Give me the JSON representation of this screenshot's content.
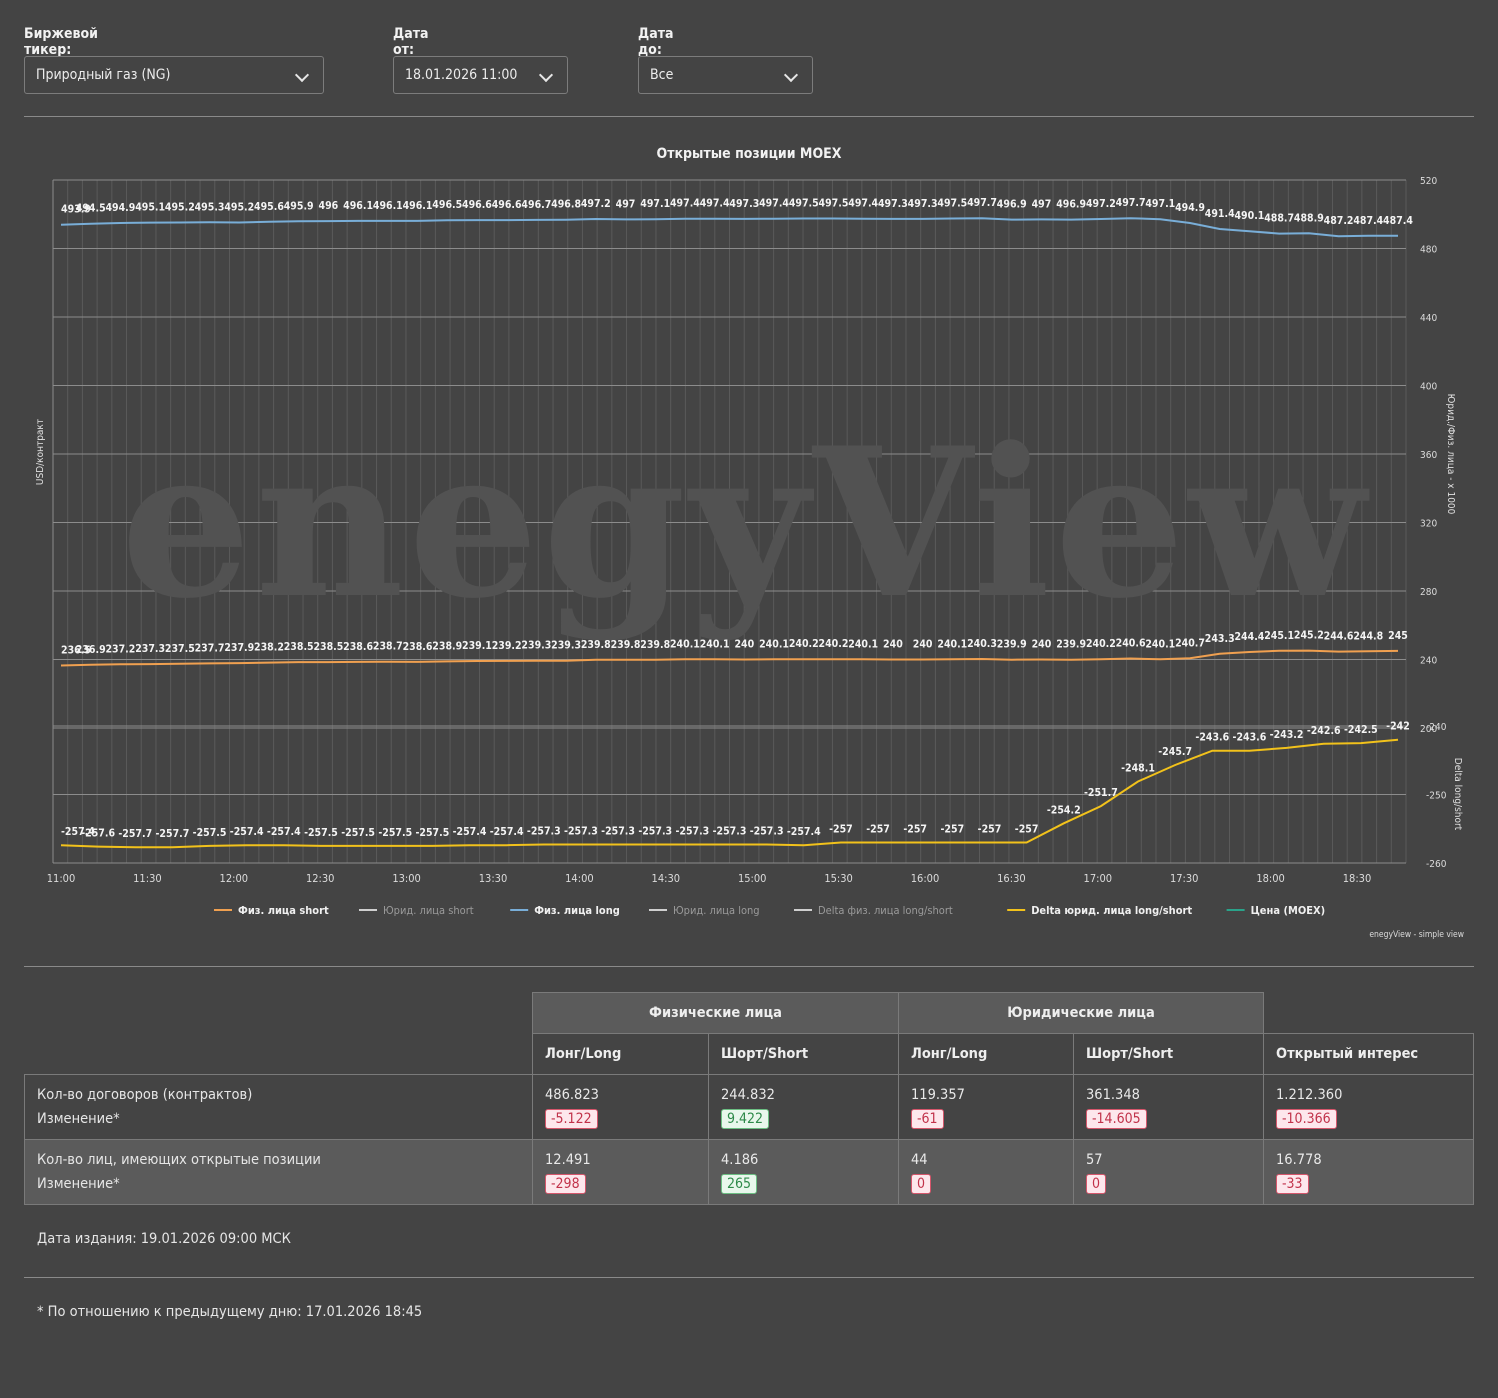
{
  "filters": {
    "ticker": {
      "label": "Биржевой тикер:",
      "value": "Природный газ (NG)"
    },
    "date_from": {
      "label": "Дата от:",
      "value": "18.01.2026 11:00"
    },
    "date_to": {
      "label": "Дата до:",
      "value": "Все"
    }
  },
  "chart_data": {
    "type": "line",
    "title": "Открытые позиции MOEX",
    "watermark": "enegyView",
    "credit": "enegyView - simple view",
    "ylabel_left": "USD/контракт",
    "ylabel_right_top": "Юрид./Физ. лица - x 1000",
    "ylabel_right_bottom": "Delta long/short",
    "top_axis": {
      "ticks": [
        "520",
        "480",
        "440",
        "400",
        "360",
        "320",
        "280",
        "240",
        "200"
      ],
      "ylim": [
        200,
        520
      ]
    },
    "bottom_axis": {
      "ticks": [
        "-240",
        "-250",
        "-260"
      ],
      "ylim": [
        -260,
        -240
      ]
    },
    "x_ticks": [
      "11:00",
      "11:30",
      "12:00",
      "12:30",
      "13:00",
      "13:30",
      "14:00",
      "14:30",
      "15:00",
      "15:30",
      "16:00",
      "16:30",
      "17:00",
      "17:30",
      "18:00",
      "18:30"
    ],
    "legend": [
      {
        "name": "Физ. лица short",
        "color": "#f0a050",
        "active": true
      },
      {
        "name": "Юрид. лица short",
        "color": "#d0d0d0",
        "active": false
      },
      {
        "name": "Физ. лица long",
        "color": "#79aed8",
        "active": true
      },
      {
        "name": "Юрид. лица long",
        "color": "#d0d0d0",
        "active": false
      },
      {
        "name": "Delta физ. лица long/short",
        "color": "#d0d0d0",
        "active": false
      },
      {
        "name": "Delta юрид. лица long/short",
        "color": "#f2c21b",
        "active": true
      },
      {
        "name": "Цена (MOEX)",
        "color": "#2aa38a",
        "active": true
      }
    ],
    "series": [
      {
        "name": "Физ. лица long",
        "color": "#79aed8",
        "axis": "top",
        "values": [
          493.9,
          494.5,
          494.9,
          495.1,
          495.2,
          495.3,
          495.2,
          495.6,
          495.9,
          496,
          496.1,
          496.1,
          496.1,
          496.5,
          496.6,
          496.6,
          496.7,
          496.8,
          497.2,
          497,
          497.1,
          497.4,
          497.4,
          497.3,
          497.4,
          497.5,
          497.5,
          497.4,
          497.3,
          497.3,
          497.5,
          497.7,
          496.9,
          497,
          496.9,
          497.2,
          497.7,
          497.1,
          494.9,
          491.4,
          490.1,
          488.7,
          488.9,
          487.2,
          487.4,
          487.4
        ]
      },
      {
        "name": "Физ. лица short",
        "color": "#f0a050",
        "axis": "top",
        "values": [
          236.5,
          236.9,
          237.2,
          237.3,
          237.5,
          237.7,
          237.9,
          238.2,
          238.5,
          238.5,
          238.6,
          238.7,
          238.6,
          238.9,
          239.1,
          239.2,
          239.3,
          239.3,
          239.8,
          239.8,
          239.8,
          240.1,
          240.1,
          240,
          240.1,
          240.2,
          240.2,
          240.1,
          240,
          240,
          240.1,
          240.3,
          239.9,
          240,
          239.9,
          240.2,
          240.6,
          240.1,
          240.7,
          243.3,
          244.4,
          245.1,
          245.2,
          244.6,
          244.8,
          245
        ]
      },
      {
        "name": "Delta юрид. лица long/short",
        "color": "#f2c21b",
        "axis": "bottom",
        "values": [
          -257.4,
          -257.6,
          -257.7,
          -257.7,
          -257.5,
          -257.4,
          -257.4,
          -257.5,
          -257.5,
          -257.5,
          -257.5,
          -257.4,
          -257.4,
          -257.3,
          -257.3,
          -257.3,
          -257.3,
          -257.3,
          -257.3,
          -257.3,
          -257.4,
          -257,
          -257,
          -257,
          -257,
          -257,
          -257,
          -254.2,
          -251.7,
          -248.1,
          -245.7,
          -243.6,
          -243.6,
          -243.2,
          -242.6,
          -242.5,
          -242
        ]
      }
    ]
  },
  "table": {
    "group_fiz": "Физические лица",
    "group_yur": "Юридические лица",
    "headers": [
      "Лонг/Long",
      "Шорт/Short",
      "Лонг/Long",
      "Шорт/Short",
      "Открытый интерес"
    ],
    "rows": [
      {
        "label": "Кол-во договоров (контрактов)",
        "sublabel": "Изменение*",
        "cells": [
          {
            "value": "486.823",
            "change": "-5.122",
            "dir": "neg"
          },
          {
            "value": "244.832",
            "change": "9.422",
            "dir": "pos"
          },
          {
            "value": "119.357",
            "change": "-61",
            "dir": "neg"
          },
          {
            "value": "361.348",
            "change": "-14.605",
            "dir": "neg"
          },
          {
            "value": "1.212.360",
            "change": "-10.366",
            "dir": "neg"
          }
        ]
      },
      {
        "label": "Кол-во лиц, имеющих открытые позиции",
        "sublabel": "Изменение*",
        "cells": [
          {
            "value": "12.491",
            "change": "-298",
            "dir": "neg"
          },
          {
            "value": "4.186",
            "change": "265",
            "dir": "pos"
          },
          {
            "value": "44",
            "change": "0",
            "dir": "neg"
          },
          {
            "value": "57",
            "change": "0",
            "dir": "neg"
          },
          {
            "value": "16.778",
            "change": "-33",
            "dir": "neg"
          }
        ]
      }
    ]
  },
  "publish_date": "Дата издания: 19.01.2026 09:00 МСК",
  "footnote": "* По отношению к предыдущему дню: 17.01.2026 18:45"
}
